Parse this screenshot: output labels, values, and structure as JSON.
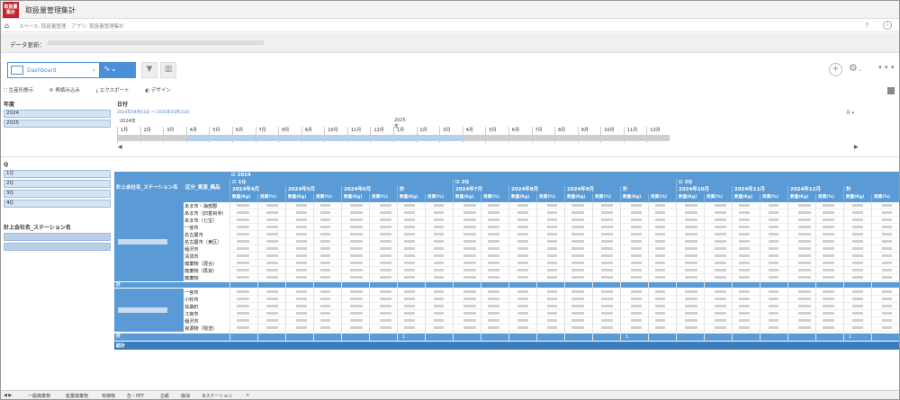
{
  "app": {
    "logo_text": "取扱量集計",
    "title": "取扱量管理集計"
  },
  "breadcrumb": {
    "space": "スペース: 取扱量管理",
    "app": "アプリ: 取扱量管理集計",
    "help": "?",
    "info": "i"
  },
  "data_update": {
    "label": "データ更新："
  },
  "toolbar": {
    "dashboard_label": "Dashboard",
    "actions": [
      "生産形態示",
      "再読み込み",
      "エクスポート",
      "デザイン"
    ]
  },
  "filters": {
    "year": {
      "title": "年度",
      "items": [
        "2024",
        "2025"
      ]
    },
    "quarter": {
      "title": "Q",
      "items": [
        "1Q",
        "2Q",
        "3Q",
        "4Q"
      ]
    },
    "company": {
      "title": "計上会社名_ステーション名",
      "items": [
        "",
        ""
      ]
    }
  },
  "date_slider": {
    "title": "日付",
    "range_text": "2024年04月01日 〜 2025年03月31日",
    "level": "月",
    "years": [
      "2024年",
      "2025年"
    ],
    "months": [
      "1月",
      "2月",
      "3月",
      "4月",
      "5月",
      "6月",
      "7月",
      "8月",
      "9月",
      "10月",
      "11月",
      "12月",
      "1月",
      "2月",
      "3月",
      "4月",
      "5月",
      "6月",
      "7月",
      "8月",
      "9月",
      "10月",
      "11月",
      "12月"
    ],
    "selected_from_index": 3,
    "selected_to_index": 14
  },
  "pivot": {
    "col1_header": "計上会社名_ステーション名",
    "col2_header": "区分_資源_廃品",
    "year": "2024",
    "quarters": [
      {
        "label": "1Q"
      },
      {
        "label": "2Q"
      },
      {
        "label": "3Q"
      }
    ],
    "months": [
      {
        "label": "2024年4月"
      },
      {
        "label": "2024年5月"
      },
      {
        "label": "2024年6月"
      },
      {
        "label": "計"
      },
      {
        "label": "2024年7月"
      },
      {
        "label": "2024年8月"
      },
      {
        "label": "2024年9月"
      },
      {
        "label": "計"
      },
      {
        "label": "2024年10月"
      },
      {
        "label": "2024年11月"
      },
      {
        "label": "2024年12月"
      },
      {
        "label": "計"
      }
    ],
    "measure_labels": [
      "数量(Kg)",
      "再資(%)"
    ],
    "group1_rows": [
      "あま市・海部郡",
      "あま市（旧甚目寺）",
      "あま市（七宝）",
      "一宮市",
      "名古屋市",
      "名古屋市（東区）",
      "稲沢市",
      "清須市",
      "廃棄物（混合）",
      "廃棄物（再資）",
      "廃棄物"
    ],
    "group2_rows": [
      "一宮市",
      "小牧市",
      "扶桑町",
      "江南市",
      "稲沢市",
      "資源物（残渣）"
    ],
    "subtotal_label": "計",
    "grand_total_label": "総計",
    "subtotal_marks": [
      "1",
      "1",
      "1"
    ]
  },
  "tabs": [
    "一般廃棄物",
    "産業廃棄物",
    "有価物",
    "缶・PET",
    "古紙",
    "廃油",
    "Bステーション",
    "+"
  ]
}
